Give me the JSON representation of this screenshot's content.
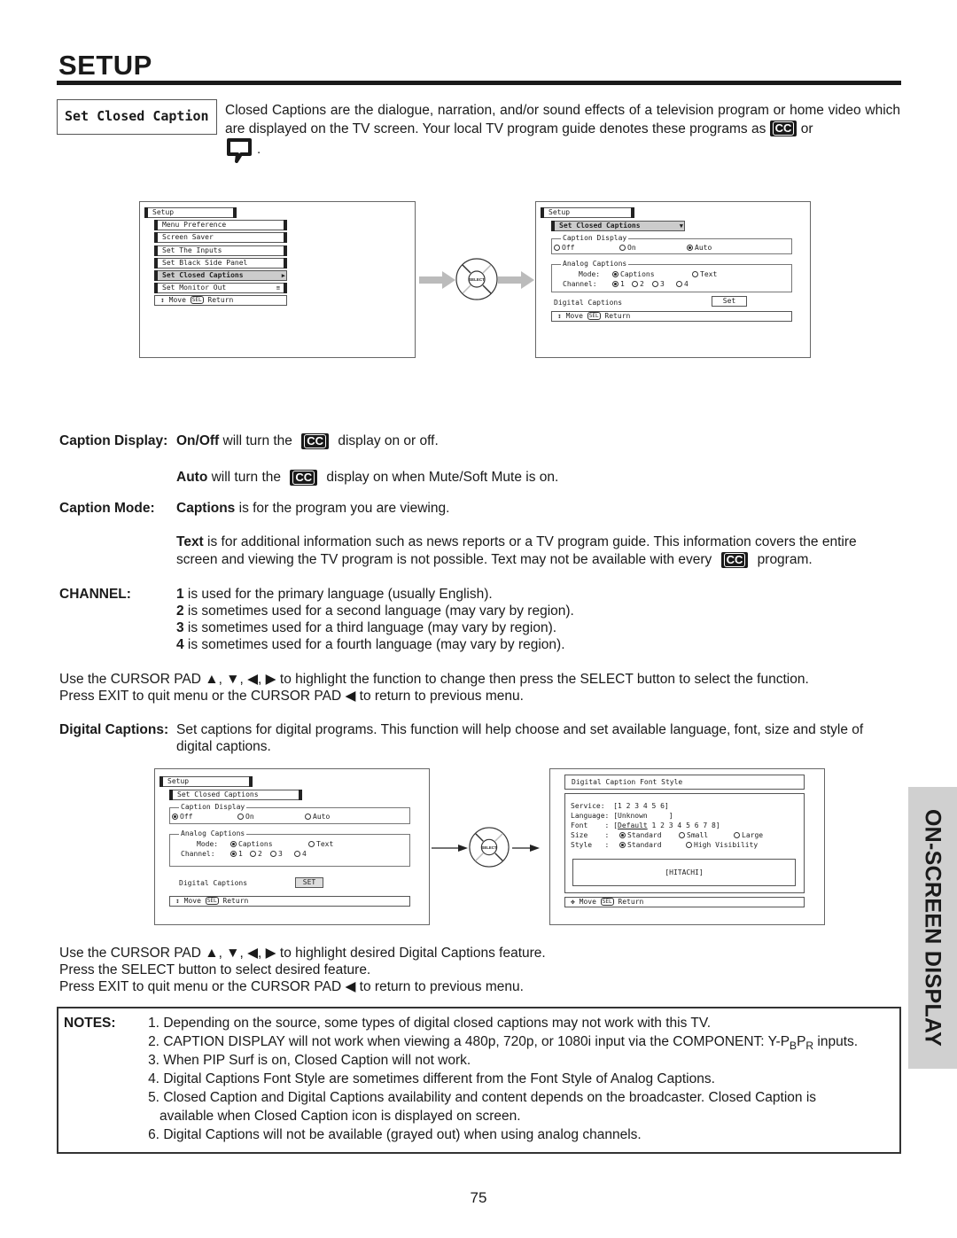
{
  "header": {
    "title": "SETUP"
  },
  "intro": {
    "label": "Set Closed Caption",
    "line1": "Closed Captions are the dialogue, narration, and/or sound effects of a television program or home video",
    "line2_pre": "which are displayed on the TV screen.  Your local TV program guide denotes these programs as",
    "line2_post": "or",
    "line3_post": ".",
    "cc_icon": "CC"
  },
  "screen1": {
    "head": "Setup",
    "items": [
      {
        "label": "Menu Preference"
      },
      {
        "label": "Screen Saver"
      },
      {
        "label": "Set The Inputs"
      },
      {
        "label": "Set Black Side Panel"
      },
      {
        "label": "Set Closed Captions",
        "selected": true
      },
      {
        "label": "Set Monitor Out"
      }
    ],
    "footer": {
      "move": "Move",
      "sel": "SEL",
      "ret": "Return"
    }
  },
  "screen2": {
    "head": "Setup",
    "sub": "Set Closed Captions",
    "caption_display": {
      "title": "Caption Display",
      "options": [
        "Off",
        "On",
        "Auto"
      ],
      "selected": "Auto"
    },
    "analog": {
      "title": "Analog Captions",
      "mode_label": "Mode:",
      "modes": [
        "Captions",
        "Text"
      ],
      "mode_selected": "Captions",
      "channel_label": "Channel:",
      "channels": [
        "1",
        "2",
        "3",
        "4"
      ],
      "channel_selected": "1"
    },
    "digital_label": "Digital Captions",
    "set_label": "Set",
    "footer": {
      "move": "Move",
      "sel": "SEL",
      "ret": "Return"
    }
  },
  "remote": {
    "label": "SELECT"
  },
  "body": {
    "caption_display_label": "Caption Display:",
    "onoff_bold": "On/Off",
    "onoff_pre": " will turn the",
    "onoff_post": "display on or off.",
    "auto_bold": "Auto",
    "auto_pre": " will turn the",
    "auto_post": "display on when Mute/Soft Mute is on.",
    "caption_mode_label": "Caption Mode:",
    "captions_bold": "Captions",
    "captions_text": " is for the program you are viewing.",
    "text_bold": "Text",
    "text_line1": " is for additional information such as news reports or a TV program guide.  This information covers the entire",
    "text_line2_pre": "screen and viewing the TV program is not possible.  Text may not be available with every",
    "text_line2_post": "program.",
    "channel_label": "CHANNEL:",
    "channels": [
      {
        "num": "1",
        "text": " is used for the primary language (usually English)."
      },
      {
        "num": "2",
        "text": " is sometimes used for a second language (may vary by region)."
      },
      {
        "num": "3",
        "text": " is sometimes used for a third language (may vary by region)."
      },
      {
        "num": "4",
        "text": " is sometimes used for a fourth language (may vary by region)."
      }
    ],
    "cursor1": "Use the CURSOR PAD ▲, ▼, ◀, ▶ to highlight the function to change then press the SELECT button to select the function.",
    "cursor2": "Press EXIT to quit menu or the CURSOR PAD ◀ to return to previous menu.",
    "digital_label": "Digital Captions:",
    "digital_line1": "Set captions for digital programs.  This function will help choose and set  available language, font, size and style of",
    "digital_line2": "digital captions.",
    "cursor3": "Use the CURSOR PAD ▲, ▼, ◀, ▶ to highlight desired Digital Captions feature.",
    "cursor4": "Press the SELECT button to select desired feature.",
    "cursor5": "Press EXIT to quit menu or the CURSOR PAD ◀ to return to previous menu."
  },
  "screen3": {
    "head": "Setup",
    "sub": "Set Closed Captions",
    "caption_display": {
      "title": "Caption Display",
      "options": [
        "Off",
        "On",
        "Auto"
      ],
      "selected": "Off"
    },
    "analog": {
      "title": "Analog Captions",
      "mode_label": "Mode:",
      "modes": [
        "Captions",
        "Text"
      ],
      "mode_selected": "Captions",
      "channel_label": "Channel:",
      "channels": [
        "1",
        "2",
        "3",
        "4"
      ],
      "channel_selected": "1"
    },
    "digital_label": "Digital Captions",
    "set_label": "SET",
    "footer": {
      "move": "Move",
      "sel": "SEL",
      "ret": "Return"
    }
  },
  "screen4": {
    "title": "Digital Caption Font Style",
    "service_label": "Service:",
    "service_value": "[1 2 3 4 5 6]",
    "language_label": "Language:",
    "language_value": "[Unknown     ]",
    "font_label": "Font    :",
    "font_default": "Default",
    "font_rest": " 1 2 3 4 5 6 7 8]",
    "size_label": "Size    :",
    "size_options": [
      "Standard",
      "Small",
      "Large"
    ],
    "size_selected": "Standard",
    "style_label": "Style   :",
    "style_options": [
      "Standard",
      "High Visibility"
    ],
    "style_selected": "Standard",
    "preview": "[HITACHI]",
    "footer": {
      "move": "Move",
      "sel": "SEL",
      "ret": "Return"
    }
  },
  "notes": {
    "label": "NOTES:",
    "items": [
      {
        "num": "1.",
        "text": "Depending on the source, some types of digital closed captions may not work with this TV."
      },
      {
        "num": "2.",
        "text": "CAPTION DISPLAY will not work when viewing a 480p, 720p, or 1080i input via the COMPONENT: Y-P",
        "sub1": "B",
        "mid": "P",
        "sub2": "R",
        "tail": " inputs."
      },
      {
        "num": "3.",
        "text": "When PIP Surf is on, Closed Caption will not work."
      },
      {
        "num": "4.",
        "text": "Digital Captions Font Style are sometimes different from the Font Style of Analog Captions."
      },
      {
        "num": "5.",
        "text": "Closed Caption and Digital Captions availability and content depends on the broadcaster.  Closed Caption is",
        "cont": "available when Closed Caption icon is displayed on screen."
      },
      {
        "num": "6.",
        "text": "Digital Captions will not be available (grayed out) when using analog channels."
      }
    ]
  },
  "side_tab": {
    "label": "ON-SCREEN DISPLAY"
  },
  "page_number": "75"
}
